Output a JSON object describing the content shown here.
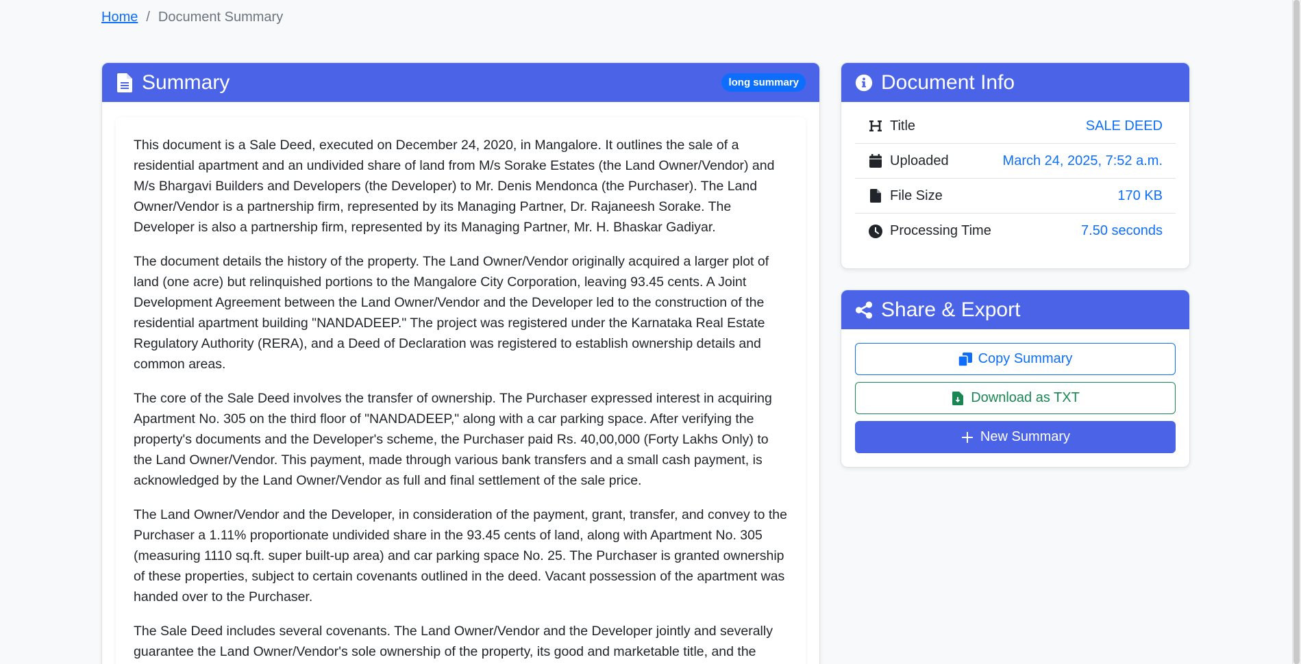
{
  "breadcrumb": {
    "home": "Home",
    "separator": "/",
    "current": "Document Summary"
  },
  "summary": {
    "title": "Summary",
    "badge": "long summary",
    "paragraphs": [
      "This document is a Sale Deed, executed on December 24, 2020, in Mangalore. It outlines the sale of a residential apartment and an undivided share of land from M/s Sorake Estates (the Land Owner/Vendor) and M/s Bhargavi Builders and Developers (the Developer) to Mr. Denis Mendonca (the Purchaser). The Land Owner/Vendor is a partnership firm, represented by its Managing Partner, Dr. Rajaneesh Sorake. The Developer is also a partnership firm, represented by its Managing Partner, Mr. H. Bhaskar Gadiyar.",
      "The document details the history of the property. The Land Owner/Vendor originally acquired a larger plot of land (one acre) but relinquished portions to the Mangalore City Corporation, leaving 93.45 cents. A Joint Development Agreement between the Land Owner/Vendor and the Developer led to the construction of the residential apartment building \"NANDADEEP.\" The project was registered under the Karnataka Real Estate Regulatory Authority (RERA), and a Deed of Declaration was registered to establish ownership details and common areas.",
      "The core of the Sale Deed involves the transfer of ownership. The Purchaser expressed interest in acquiring Apartment No. 305 on the third floor of \"NANDADEEP,\" along with a car parking space. After verifying the property's documents and the Developer's scheme, the Purchaser paid Rs. 40,00,000 (Forty Lakhs Only) to the Land Owner/Vendor. This payment, made through various bank transfers and a small cash payment, is acknowledged by the Land Owner/Vendor as full and final settlement of the sale price.",
      "The Land Owner/Vendor and the Developer, in consideration of the payment, grant, transfer, and convey to the Purchaser a 1.11% proportionate undivided share in the 93.45 cents of land, along with Apartment No. 305 (measuring 1110 sq.ft. super built-up area) and car parking space No. 25. The Purchaser is granted ownership of these properties, subject to certain covenants outlined in the deed. Vacant possession of the apartment was handed over to the Purchaser.",
      "The Sale Deed includes several covenants. The Land Owner/Vendor and the Developer jointly and severally guarantee the Land Owner/Vendor's sole ownership of the property, its good and marketable title, and the"
    ]
  },
  "info": {
    "title": "Document Info",
    "rows": [
      {
        "icon": "heading-icon",
        "label": "Title",
        "value": "SALE DEED"
      },
      {
        "icon": "calendar-icon",
        "label": "Uploaded",
        "value": "March 24, 2025, 7:52 a.m."
      },
      {
        "icon": "file-icon",
        "label": "File Size",
        "value": "170 KB"
      },
      {
        "icon": "clock-icon",
        "label": "Processing Time",
        "value": "7.50 seconds"
      }
    ]
  },
  "share": {
    "title": "Share & Export",
    "copy_label": "Copy Summary",
    "download_label": "Download as TXT",
    "new_label": "New Summary"
  },
  "colors": {
    "header_bg": "#4a63e7",
    "link": "#0d6efd",
    "success": "#198754",
    "badge_bg": "#0d6efd"
  }
}
